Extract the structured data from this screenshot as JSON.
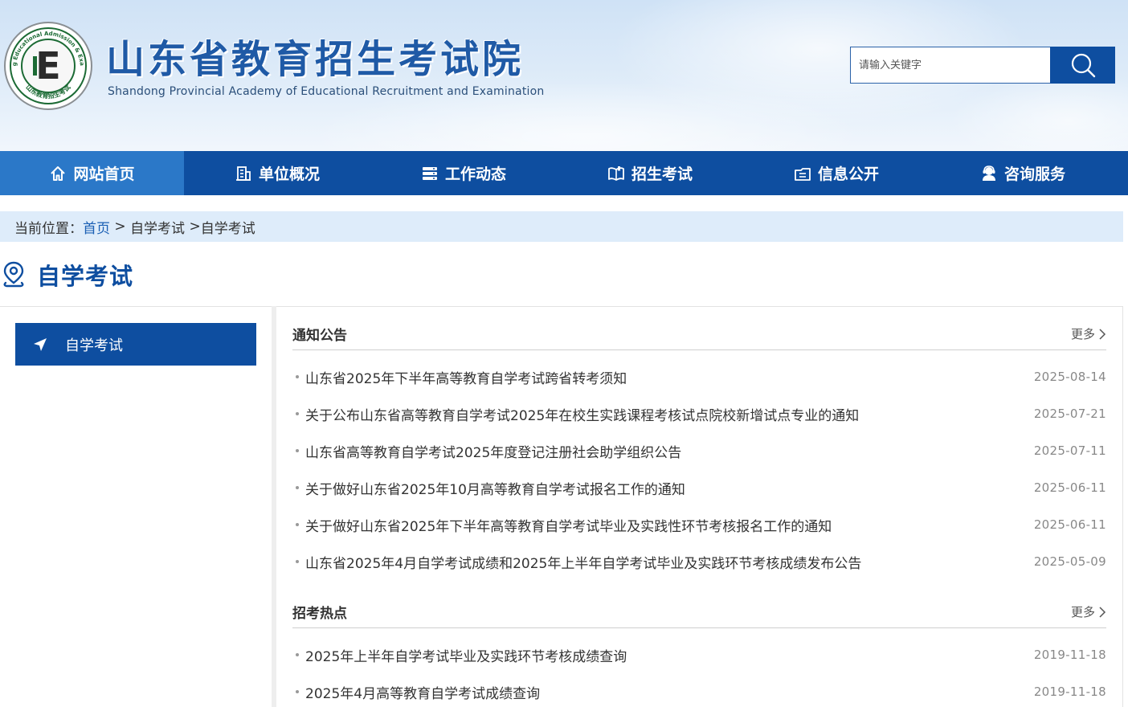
{
  "header": {
    "site_title": "山东省教育招生考试院",
    "site_subtitle": "Shandong Provincial Academy of Educational Recruitment and Examination",
    "logo_letter": "E",
    "logo_text_top": "Shandong Educational Admission & Examination",
    "logo_text_bottom": "山东教育招生考试",
    "search_placeholder": "请输入关键字",
    "search_icon": "search-icon"
  },
  "nav": {
    "items": [
      {
        "label": "网站首页",
        "icon": "home-icon"
      },
      {
        "label": "单位概况",
        "icon": "building-icon"
      },
      {
        "label": "工作动态",
        "icon": "list-icon"
      },
      {
        "label": "招生考试",
        "icon": "book-icon"
      },
      {
        "label": "信息公开",
        "icon": "folder-icon"
      },
      {
        "label": "咨询服务",
        "icon": "support-icon"
      }
    ]
  },
  "breadcrumb": {
    "prefix": "当前位置：",
    "home": "首页",
    "sep1": " > ",
    "level1": "自学考试",
    "sep2": " >",
    "level2": "自学考试"
  },
  "section": {
    "title": "自学考试"
  },
  "sidebar": {
    "items": [
      {
        "label": "自学考试"
      }
    ]
  },
  "panels": [
    {
      "title": "通知公告",
      "more": "更多",
      "items": [
        {
          "title": "山东省2025年下半年高等教育自学考试跨省转考须知",
          "date": "2025-08-14"
        },
        {
          "title": "关于公布山东省高等教育自学考试2025年在校生实践课程考核试点院校新增试点专业的通知",
          "date": "2025-07-21"
        },
        {
          "title": "山东省高等教育自学考试2025年度登记注册社会助学组织公告",
          "date": "2025-07-11"
        },
        {
          "title": "关于做好山东省2025年10月高等教育自学考试报名工作的通知",
          "date": "2025-06-11"
        },
        {
          "title": "关于做好山东省2025年下半年高等教育自学考试毕业及实践性环节考核报名工作的通知",
          "date": "2025-06-11"
        },
        {
          "title": "山东省2025年4月自学考试成绩和2025年上半年自学考试毕业及实践环节考核成绩发布公告",
          "date": "2025-05-09"
        }
      ]
    },
    {
      "title": "招考热点",
      "more": "更多",
      "items": [
        {
          "title": "2025年上半年自学考试毕业及实践环节考核成绩查询",
          "date": "2019-11-18"
        },
        {
          "title": "2025年4月高等教育自学考试成绩查询",
          "date": "2019-11-18"
        }
      ]
    }
  ],
  "colors": {
    "primary": "#0e4ea0",
    "nav_active": "#2b78c8",
    "breadcrumb_bg": "#deecfa",
    "link": "#1a5fb4"
  }
}
